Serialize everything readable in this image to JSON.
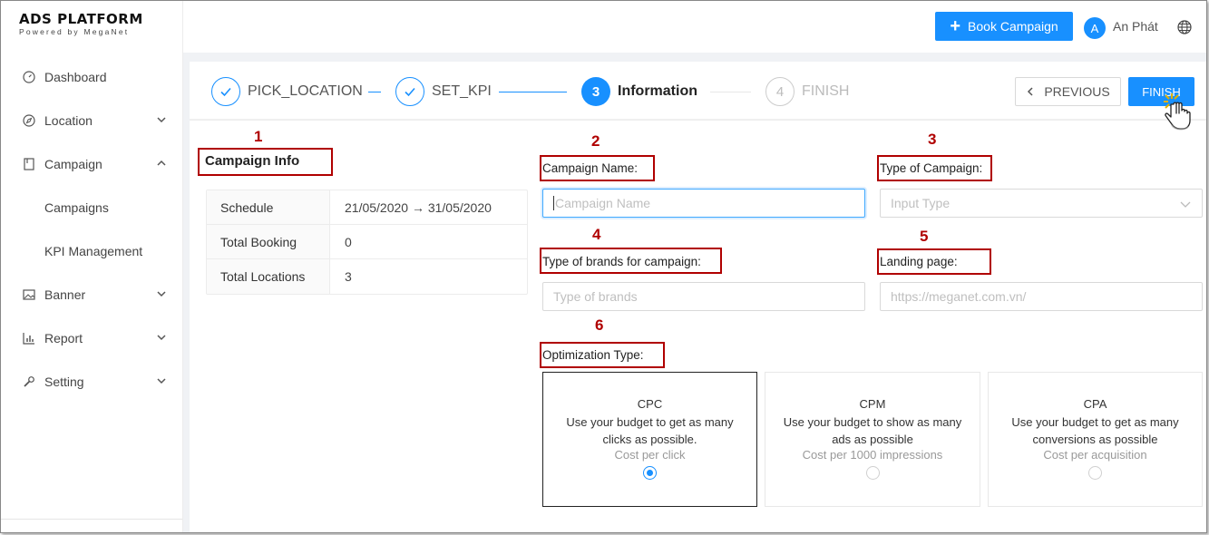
{
  "app": {
    "logo_title": "ADS PLATFORM",
    "logo_subtitle": "Powered by MegaNet"
  },
  "sidebar": {
    "items": [
      {
        "label": "Dashboard",
        "icon": "dashboard-icon"
      },
      {
        "label": "Location",
        "icon": "compass-icon",
        "expandable": true
      },
      {
        "label": "Campaign",
        "icon": "book-icon",
        "expanded": true
      },
      {
        "label": "Campaigns",
        "sub": true
      },
      {
        "label": "KPI Management",
        "sub": true
      },
      {
        "label": "Banner",
        "icon": "picture-icon",
        "expandable": true
      },
      {
        "label": "Report",
        "icon": "bar-chart-icon",
        "expandable": true
      },
      {
        "label": "Setting",
        "icon": "wrench-icon",
        "expandable": true
      }
    ]
  },
  "header": {
    "book_button": "Book Campaign",
    "avatar_letter": "A",
    "user_name": "An Phát"
  },
  "steps": [
    {
      "label": "PICK_LOCATION",
      "status": "done"
    },
    {
      "label": "SET_KPI",
      "status": "done"
    },
    {
      "number": "3",
      "label": "Information",
      "status": "active"
    },
    {
      "number": "4",
      "label": "FINISH",
      "status": "wait"
    }
  ],
  "actions": {
    "previous": "PREVIOUS",
    "finish": "FINISH"
  },
  "annotations": [
    "1",
    "2",
    "3",
    "4",
    "5",
    "6"
  ],
  "campaign_info": {
    "title": "Campaign Info",
    "rows": [
      {
        "key": "Schedule",
        "value": "21/05/2020 → 31/05/2020"
      },
      {
        "key": "Total Booking",
        "value": "0"
      },
      {
        "key": "Total Locations",
        "value": "3"
      }
    ]
  },
  "form": {
    "campaign_name": {
      "label": "Campaign Name:",
      "placeholder": "Campaign Name"
    },
    "campaign_type": {
      "label": "Type of Campaign:",
      "placeholder": "Input Type"
    },
    "brand_type": {
      "label": "Type of brands for campaign:",
      "placeholder": "Type of brands"
    },
    "landing_page": {
      "label": "Landing page:",
      "placeholder": "https://meganet.com.vn/"
    },
    "optimization": {
      "label": "Optimization Type:",
      "options": [
        {
          "title": "CPC",
          "desc": "Use your budget to get as many clicks as possible.",
          "sub": "Cost per click",
          "selected": true
        },
        {
          "title": "CPM",
          "desc": "Use your budget to show as many ads as possible",
          "sub": "Cost per 1000 impressions",
          "selected": false
        },
        {
          "title": "CPA",
          "desc": "Use your budget to get as many conversions as possible",
          "sub": "Cost per acquisition",
          "selected": false
        }
      ]
    }
  },
  "colors": {
    "primary": "#1890ff",
    "annotation": "#b00000"
  }
}
